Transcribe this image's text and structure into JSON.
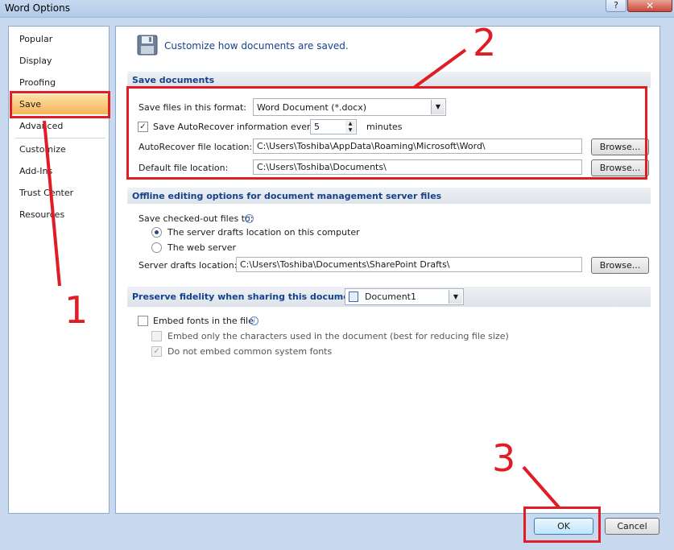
{
  "window": {
    "title": "Word Options",
    "help_label": "?",
    "close_label": "✕"
  },
  "sidebar": {
    "items": [
      {
        "label": "Popular"
      },
      {
        "label": "Display"
      },
      {
        "label": "Proofing"
      },
      {
        "label": "Save"
      },
      {
        "label": "Advanced"
      },
      {
        "label": "Customize"
      },
      {
        "label": "Add-Ins"
      },
      {
        "label": "Trust Center"
      },
      {
        "label": "Resources"
      }
    ],
    "selected": "Save"
  },
  "header": {
    "icon": "floppy-disk-icon",
    "text": "Customize how documents are saved."
  },
  "save_documents": {
    "title": "Save documents",
    "format_label": "Save files in this format:",
    "format_value": "Word Document (*.docx)",
    "autorecover_label": "Save AutoRecover information every",
    "autorecover_checked": true,
    "autorecover_minutes": "5",
    "minutes_label": "minutes",
    "autorecover_location_label": "AutoRecover file location:",
    "autorecover_location_value": "C:\\Users\\Toshiba\\AppData\\Roaming\\Microsoft\\Word\\",
    "default_location_label": "Default file location:",
    "default_location_value": "C:\\Users\\Toshiba\\Documents\\",
    "browse_label": "Browse..."
  },
  "offline": {
    "title": "Offline editing options for document management server files",
    "checked_out_label": "Save checked-out files to:",
    "option_server": "The server drafts location on this computer",
    "option_web": "The web server",
    "selected_option": "server",
    "server_drafts_label": "Server drafts location:",
    "server_drafts_value": "C:\\Users\\Toshiba\\Documents\\SharePoint Drafts\\",
    "browse_label": "Browse..."
  },
  "fidelity": {
    "title": "Preserve fidelity when sharing this document:",
    "document_value": "Document1",
    "embed_fonts_label": "Embed fonts in the file",
    "embed_fonts_checked": false,
    "embed_chars_label": "Embed only the characters used in the document (best for reducing file size)",
    "no_common_label": "Do not embed common system fonts",
    "no_common_checked": true
  },
  "buttons": {
    "ok_label": "OK",
    "cancel_label": "Cancel"
  },
  "annotations": {
    "num1": "1",
    "num2": "2",
    "num3": "3",
    "color": "#e01c24"
  }
}
